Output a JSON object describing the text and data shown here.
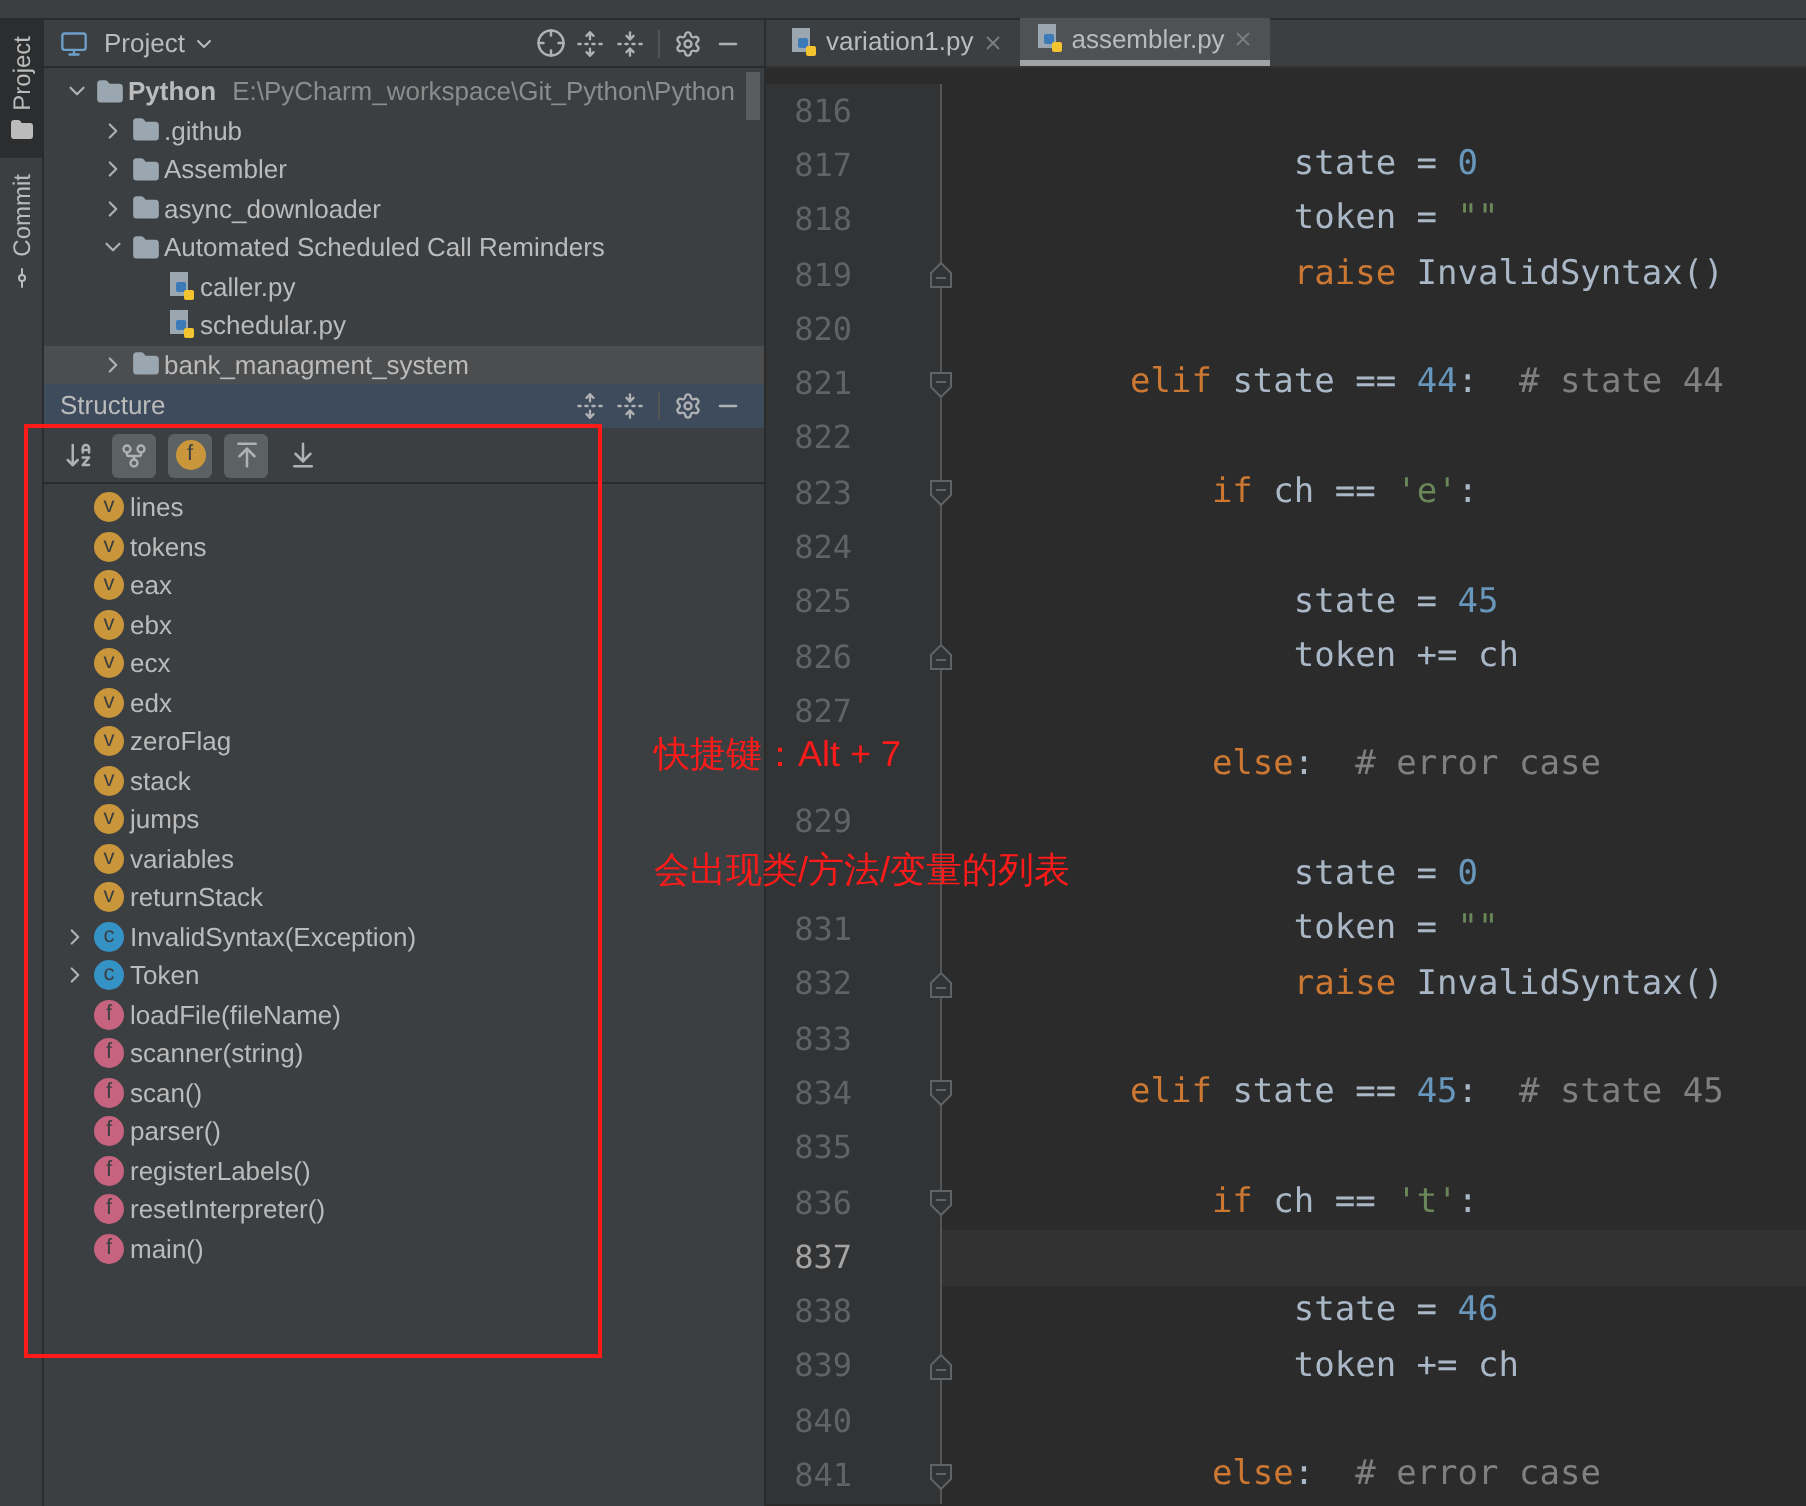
{
  "tool_strip": [
    {
      "label": "Project",
      "selected": true
    },
    {
      "label": "Commit",
      "selected": false
    }
  ],
  "project": {
    "title": "Project",
    "tree": [
      {
        "label": "Python",
        "path": "E:\\PyCharm_workspace\\Git_Python\\Python",
        "kind": "folder",
        "expanded": true,
        "selected": false,
        "children": [
          {
            "label": ".github",
            "kind": "folder",
            "expanded": false,
            "selected": false
          },
          {
            "label": "Assembler",
            "kind": "folder",
            "expanded": false,
            "selected": false
          },
          {
            "label": "async_downloader",
            "kind": "folder",
            "expanded": false,
            "selected": false
          },
          {
            "label": "Automated Scheduled Call Reminders",
            "kind": "folder",
            "expanded": true,
            "selected": false,
            "children": [
              {
                "label": "caller.py",
                "kind": "file",
                "selected": false
              },
              {
                "label": "schedular.py",
                "kind": "file",
                "selected": false
              }
            ]
          },
          {
            "label": "bank_managment_system",
            "kind": "folder",
            "expanded": false,
            "selected": true
          }
        ]
      }
    ]
  },
  "structure": {
    "title": "Structure",
    "toolbar": [
      {
        "kind": "sort",
        "on": false
      },
      {
        "kind": "inherited",
        "on": true
      },
      {
        "kind": "fields",
        "badge": "f",
        "on": true
      },
      {
        "kind": "expand",
        "on": true
      },
      {
        "kind": "collapse",
        "on": false
      }
    ],
    "items": [
      {
        "kind": "variable",
        "badge": "v",
        "label": "lines"
      },
      {
        "kind": "variable",
        "badge": "v",
        "label": "tokens"
      },
      {
        "kind": "variable",
        "badge": "v",
        "label": "eax"
      },
      {
        "kind": "variable",
        "badge": "v",
        "label": "ebx"
      },
      {
        "kind": "variable",
        "badge": "v",
        "label": "ecx"
      },
      {
        "kind": "variable",
        "badge": "v",
        "label": "edx"
      },
      {
        "kind": "variable",
        "badge": "v",
        "label": "zeroFlag"
      },
      {
        "kind": "variable",
        "badge": "v",
        "label": "stack"
      },
      {
        "kind": "variable",
        "badge": "v",
        "label": "jumps"
      },
      {
        "kind": "variable",
        "badge": "v",
        "label": "variables"
      },
      {
        "kind": "variable",
        "badge": "v",
        "label": "returnStack"
      },
      {
        "kind": "class",
        "badge": "c",
        "label": "InvalidSyntax(Exception)",
        "expanded": false
      },
      {
        "kind": "class",
        "badge": "c",
        "label": "Token",
        "expanded": false
      },
      {
        "kind": "function",
        "badge": "f",
        "label": "loadFile(fileName)"
      },
      {
        "kind": "function",
        "badge": "f",
        "label": "scanner(string)"
      },
      {
        "kind": "function",
        "badge": "f",
        "label": "scan()"
      },
      {
        "kind": "function",
        "badge": "f",
        "label": "parser()"
      },
      {
        "kind": "function",
        "badge": "f",
        "label": "registerLabels()"
      },
      {
        "kind": "function",
        "badge": "f",
        "label": "resetInterpreter()"
      },
      {
        "kind": "function",
        "badge": "f",
        "label": "main()"
      }
    ]
  },
  "tabs": [
    {
      "label": "variation1.py",
      "selected": false
    },
    {
      "label": "assembler.py",
      "selected": true
    }
  ],
  "editor": {
    "lines": [
      {
        "number": "816",
        "kind": "plain",
        "current": false
      },
      {
        "number": "817",
        "kind": "plain",
        "current": false,
        "tokens": [
          {
            "kind": "plain",
            "text": "        state = "
          },
          {
            "kind": "number",
            "text": "0"
          }
        ]
      },
      {
        "number": "818",
        "kind": "plain",
        "current": false,
        "tokens": [
          {
            "kind": "plain",
            "text": "        token = "
          },
          {
            "kind": "string",
            "text": "\"\""
          }
        ]
      },
      {
        "number": "819",
        "kind": "fold-end",
        "current": false,
        "tokens": [
          {
            "kind": "keyword",
            "text": "        raise"
          },
          {
            "kind": "plain",
            "text": " InvalidSyntax()"
          }
        ]
      },
      {
        "number": "820",
        "kind": "plain",
        "current": false
      },
      {
        "number": "821",
        "kind": "fold-start",
        "current": false,
        "tokens": [
          {
            "kind": "keyword",
            "text": "elif"
          },
          {
            "kind": "plain",
            "text": " state == "
          },
          {
            "kind": "number",
            "text": "44"
          },
          {
            "kind": "plain",
            "text": ":  "
          },
          {
            "kind": "comment",
            "text": "# state 44"
          }
        ]
      },
      {
        "number": "822",
        "kind": "plain",
        "current": false
      },
      {
        "number": "823",
        "kind": "fold-start",
        "current": false,
        "tokens": [
          {
            "kind": "keyword",
            "text": "    if"
          },
          {
            "kind": "plain",
            "text": " ch == "
          },
          {
            "kind": "string",
            "text": "'e'"
          },
          {
            "kind": "plain",
            "text": ":"
          }
        ]
      },
      {
        "number": "824",
        "kind": "plain",
        "current": false
      },
      {
        "number": "825",
        "kind": "plain",
        "current": false,
        "tokens": [
          {
            "kind": "plain",
            "text": "        state = "
          },
          {
            "kind": "number",
            "text": "45"
          }
        ]
      },
      {
        "number": "826",
        "kind": "fold-end",
        "current": false,
        "tokens": [
          {
            "kind": "plain",
            "text": "        token += ch"
          }
        ]
      },
      {
        "number": "827",
        "kind": "plain",
        "current": false
      },
      {
        "kind": "plain",
        "tokens": [
          {
            "kind": "keyword",
            "text": "    else"
          },
          {
            "kind": "plain",
            "text": ":  "
          },
          {
            "kind": "comment",
            "text": "# error case"
          }
        ]
      },
      {
        "number": "829",
        "kind": "plain",
        "current": false
      },
      {
        "kind": "plain",
        "tokens": [
          {
            "kind": "plain",
            "text": "        state = "
          },
          {
            "kind": "number",
            "text": "0"
          }
        ]
      },
      {
        "number": "831",
        "kind": "plain",
        "current": false,
        "tokens": [
          {
            "kind": "plain",
            "text": "        token = "
          },
          {
            "kind": "string",
            "text": "\"\""
          }
        ]
      },
      {
        "number": "832",
        "kind": "fold-end",
        "current": false,
        "tokens": [
          {
            "kind": "keyword",
            "text": "        raise"
          },
          {
            "kind": "plain",
            "text": " InvalidSyntax()"
          }
        ]
      },
      {
        "number": "833",
        "kind": "plain",
        "current": false
      },
      {
        "number": "834",
        "kind": "fold-start",
        "current": false,
        "tokens": [
          {
            "kind": "keyword",
            "text": "elif"
          },
          {
            "kind": "plain",
            "text": " state == "
          },
          {
            "kind": "number",
            "text": "45"
          },
          {
            "kind": "plain",
            "text": ":  "
          },
          {
            "kind": "comment",
            "text": "# state 45"
          }
        ]
      },
      {
        "number": "835",
        "kind": "plain",
        "current": false
      },
      {
        "number": "836",
        "kind": "fold-start",
        "current": false,
        "tokens": [
          {
            "kind": "keyword",
            "text": "    if"
          },
          {
            "kind": "plain",
            "text": " ch == "
          },
          {
            "kind": "string",
            "text": "'t'"
          },
          {
            "kind": "plain",
            "text": ":"
          }
        ]
      },
      {
        "number": "837",
        "kind": "plain",
        "current": true
      },
      {
        "number": "838",
        "kind": "plain",
        "current": false,
        "tokens": [
          {
            "kind": "plain",
            "text": "        state = "
          },
          {
            "kind": "number",
            "text": "46"
          }
        ]
      },
      {
        "number": "839",
        "kind": "fold-end",
        "current": false,
        "tokens": [
          {
            "kind": "plain",
            "text": "        token += ch"
          }
        ]
      },
      {
        "number": "840",
        "kind": "plain",
        "current": false
      },
      {
        "number": "841",
        "kind": "fold-start",
        "current": false,
        "tokens": [
          {
            "kind": "keyword",
            "text": "    else"
          },
          {
            "kind": "plain",
            "text": ":  "
          },
          {
            "kind": "comment",
            "text": "# error case"
          }
        ]
      }
    ]
  },
  "annotation": {
    "lines": [
      "快捷键：Alt + 7",
      "会出现类/方法/变量的列表"
    ]
  }
}
